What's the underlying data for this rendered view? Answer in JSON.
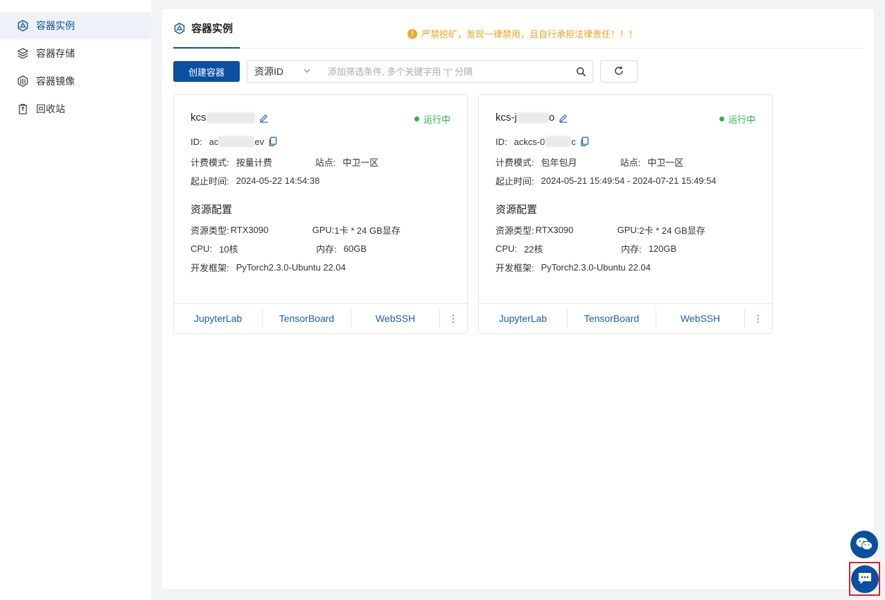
{
  "sidebar": {
    "items": [
      {
        "label": "容器实例",
        "icon": "container-instance-icon",
        "active": true
      },
      {
        "label": "容器存储",
        "icon": "storage-stack-icon"
      },
      {
        "label": "容器镜像",
        "icon": "image-layers-icon"
      },
      {
        "label": "回收站",
        "icon": "recycle-bin-icon"
      }
    ]
  },
  "tabs": {
    "active_label": "容器实例"
  },
  "warning": {
    "text": "严禁挖矿，发现一律禁用，且自行承担法律责任！！！",
    "icon_glyph": "!"
  },
  "toolbar": {
    "create_label": "创建容器",
    "filter_select": "资源ID",
    "search_placeholder": "添加筛选条件, 多个关键字用 \"|\" 分隔"
  },
  "cards": [
    {
      "name_prefix": "kcs",
      "status": "运行中",
      "id_label": "ID:",
      "id_prefix": "ac",
      "id_suffix": "ev",
      "billing_label": "计费模式:",
      "billing": "按量计费",
      "site_label": "站点:",
      "site": "中卫一区",
      "time_label": "起止时间:",
      "time": "2024-05-22 14:54:38",
      "section": "资源配置",
      "rtype_label": "资源类型:",
      "rtype": "RTX3090",
      "gpu_label": "GPU:",
      "gpu": "1卡 * 24 GB显存",
      "cpu_label": "CPU:",
      "cpu": "10核",
      "mem_label": "内存:",
      "mem": "60GB",
      "fw_label": "开发框架:",
      "fw": "PyTorch2.3.0-Ubuntu 22.04",
      "links": [
        "JupyterLab",
        "TensorBoard",
        "WebSSH"
      ],
      "more": "⋮"
    },
    {
      "name_prefix": "kcs-j",
      "name_suffix": "o",
      "status": "运行中",
      "id_label": "ID:",
      "id_prefix": "ackcs-0",
      "id_suffix": "c",
      "billing_label": "计费模式:",
      "billing": "包年包月",
      "site_label": "站点:",
      "site": "中卫一区",
      "time_label": "起止时间:",
      "time": "2024-05-21 15:49:54 - 2024-07-21 15:49:54",
      "section": "资源配置",
      "rtype_label": "资源类型:",
      "rtype": "RTX3090",
      "gpu_label": "GPU:",
      "gpu": "2卡 * 24 GB显存",
      "cpu_label": "CPU:",
      "cpu": "22核",
      "mem_label": "内存:",
      "mem": "120GB",
      "fw_label": "开发框架:",
      "fw": "PyTorch2.3.0-Ubuntu 22.04",
      "links": [
        "JupyterLab",
        "TensorBoard",
        "WebSSH"
      ],
      "more": "⋮"
    }
  ],
  "colors": {
    "primary": "#0b4fa1",
    "running": "#27b148",
    "warning": "#f0a020",
    "link": "#1a5bb5"
  }
}
